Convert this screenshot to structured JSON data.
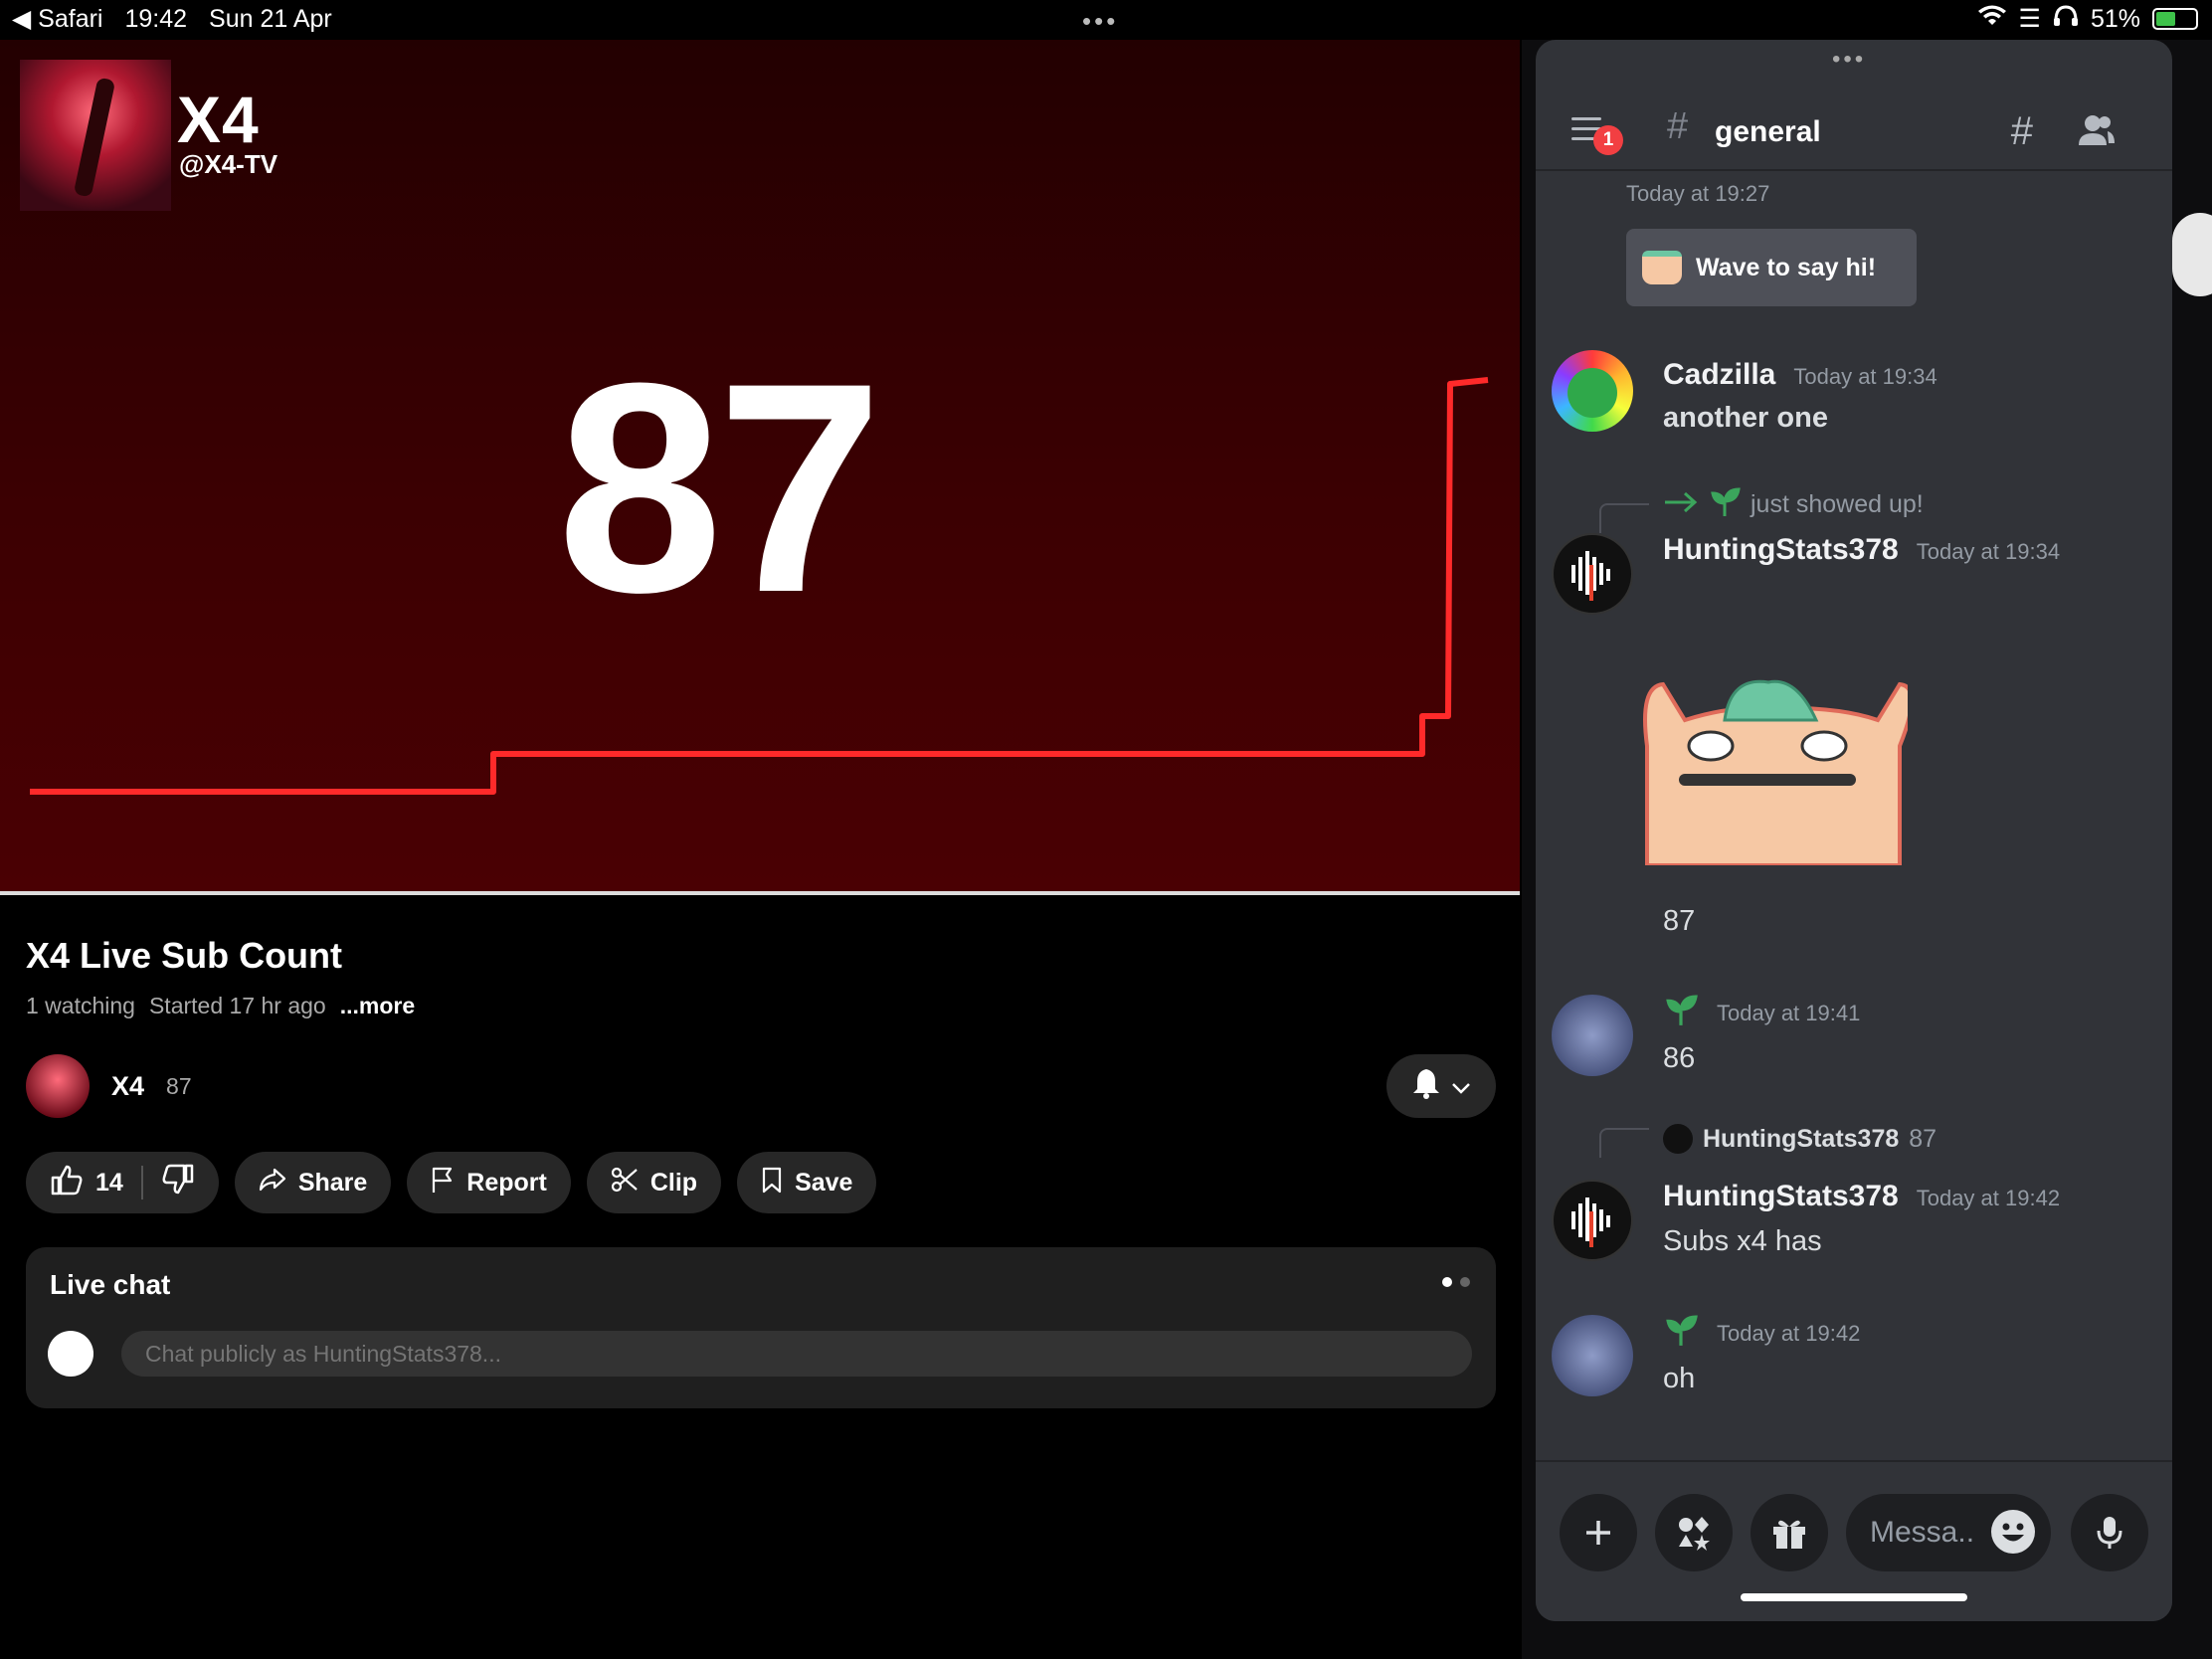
{
  "status_bar": {
    "back_app": "◀ Safari",
    "time": "19:42",
    "date": "Sun 21 Apr",
    "battery": "51%",
    "battery_level": 0.51
  },
  "video": {
    "channel_title": "X4",
    "channel_handle": "@X4-TV",
    "count": "87",
    "title": "X4 Live Sub Count",
    "watching": "1 watching",
    "started": "Started 17 hr ago",
    "more": "...more",
    "channel_name": "X4",
    "channel_subs": "87",
    "likes": "14",
    "share": "Share",
    "report": "Report",
    "clip": "Clip",
    "save": "Save"
  },
  "live_chat": {
    "title": "Live chat",
    "placeholder": "Chat publicly as HuntingStats378..."
  },
  "discord": {
    "badge": "1",
    "channel": "general",
    "messages": [
      {
        "time": "Today at 19:27",
        "wave_label": "Wave to say hi!"
      },
      {
        "author": "Cadzilla",
        "time": "Today at 19:34",
        "text": "another one"
      },
      {
        "system": "just showed up!",
        "author": "HuntingStats378",
        "time": "Today at 19:34",
        "text": "87"
      },
      {
        "time": "Today at 19:41",
        "text": "86"
      },
      {
        "reply_author": "HuntingStats378",
        "reply_text": "87",
        "author": "HuntingStats378",
        "time": "Today at 19:42",
        "text": "Subs x4 has"
      },
      {
        "time": "Today at 19:42",
        "text": "oh"
      }
    ],
    "input_placeholder": "Messa.."
  },
  "colors": {
    "discord_bg": "#313338",
    "youtube_chip": "#272727",
    "chart_line": "#ff2a2a",
    "discord_badge": "#f23f42"
  }
}
